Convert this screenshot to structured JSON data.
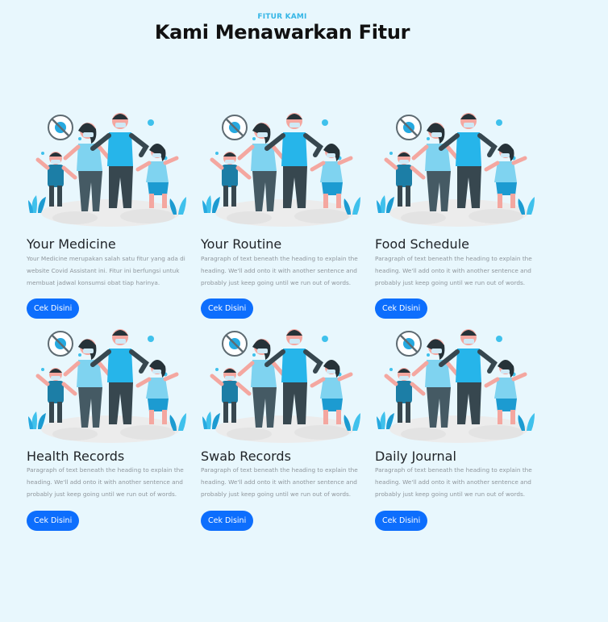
{
  "section": {
    "eyebrow": "FITUR KAMI",
    "heading": "Kami Menawarkan Fitur"
  },
  "cards": [
    {
      "title": "Your Medicine",
      "text": "Your Medicine merupakan salah satu fitur yang ada di website Covid Assistant ini. Fitur ini berfungsi untuk membuat jadwal konsumsi obat tiap harinya.",
      "button": "Cek Disini"
    },
    {
      "title": "Your Routine",
      "text": "Paragraph of text beneath the heading to explain the heading. We'll add onto it with another sentence and probably just keep going until we run out of words.",
      "button": "Cek Disini"
    },
    {
      "title": "Food Schedule",
      "text": "Paragraph of text beneath the heading to explain the heading. We'll add onto it with another sentence and probably just keep going until we run out of words.",
      "button": "Cek Disini"
    },
    {
      "title": "Health Records",
      "text": "Paragraph of text beneath the heading to explain the heading. We'll add onto it with another sentence and probably just keep going until we run out of words.",
      "button": "Cek Disini"
    },
    {
      "title": "Swab Records",
      "text": "Paragraph of text beneath the heading to explain the heading. We'll add onto it with another sentence and probably just keep going until we run out of words.",
      "button": "Cek Disini"
    },
    {
      "title": "Daily Journal",
      "text": "Paragraph of text beneath the heading to explain the heading. We'll add onto it with another sentence and probably just keep going until we run out of words.",
      "button": "Cek Disini"
    }
  ],
  "colors": {
    "page_background": "#e8f7fd",
    "accent": "#35b6e6",
    "button": "#0d6efd",
    "illustration_blue": "#3fc1ec",
    "illustration_dark": "#37474f"
  },
  "icons": [
    "family-masks-illustration"
  ]
}
